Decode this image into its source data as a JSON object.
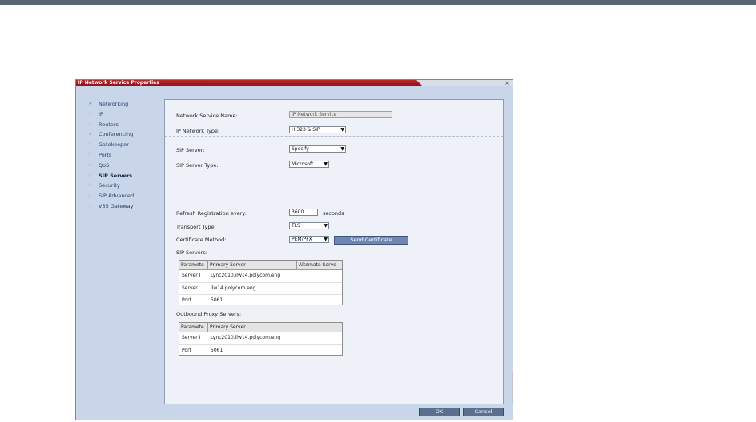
{
  "dialog": {
    "title": "IP Network Service Properties",
    "close_glyph": "×"
  },
  "nav": {
    "items": [
      {
        "label": "Networking",
        "arrow": "»",
        "active": false
      },
      {
        "label": "IP",
        "arrow": "›",
        "active": false
      },
      {
        "label": "Routers",
        "arrow": "›",
        "active": false
      },
      {
        "label": "Conferencing",
        "arrow": "»",
        "active": false
      },
      {
        "label": "Gatekeeper",
        "arrow": "›",
        "active": false
      },
      {
        "label": "Ports",
        "arrow": "›",
        "active": false
      },
      {
        "label": "QoS",
        "arrow": "›",
        "active": false
      },
      {
        "label": "SIP Servers",
        "arrow": "›",
        "active": true
      },
      {
        "label": "Security",
        "arrow": "›",
        "active": false
      },
      {
        "label": "SIP Advanced",
        "arrow": "›",
        "active": false
      },
      {
        "label": "V35 Gateway",
        "arrow": "›",
        "active": false
      }
    ]
  },
  "form": {
    "service_name_label": "Network Service Name:",
    "service_name_value": "IP Network Service",
    "network_type_label": "IP Network Type:",
    "network_type_value": "H.323 & SIP",
    "sip_server_label": "SIP Server:",
    "sip_server_value": "Specify",
    "sip_server_type_label": "SIP Server Type:",
    "sip_server_type_value": "Microsoft",
    "refresh_label": "Refresh Registration every:",
    "refresh_value": "3600",
    "refresh_unit": "seconds",
    "transport_label": "Transport Type:",
    "transport_value": "TLS",
    "cert_method_label": "Certificate Method:",
    "cert_method_value": "PEM/PFX",
    "send_cert_label": "Send Certificate",
    "dropdown_glyph": "▼"
  },
  "sip_servers": {
    "label": "SIP Servers:",
    "headers": [
      "Paramete",
      "Primary Server",
      "Alternate Serve"
    ],
    "rows": [
      [
        "Server I",
        "Lync2010.ilw14.polycom.eng",
        ""
      ],
      [
        "Server",
        "ilw14.polycom.eng",
        ""
      ],
      [
        "Port",
        "5061",
        ""
      ]
    ]
  },
  "proxy_servers": {
    "label": "Outbound Proxy Servers:",
    "headers": [
      "Paramete",
      "Primary Server"
    ],
    "rows": [
      [
        "Server I",
        "Lync2010.ilw14.polycom.eng"
      ],
      [
        "Port",
        "5061"
      ]
    ]
  },
  "footer": {
    "ok_label": "OK",
    "cancel_label": "Cancel"
  }
}
